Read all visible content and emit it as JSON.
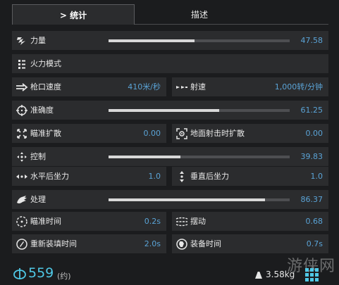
{
  "tabs": [
    {
      "label": "> 统计"
    },
    {
      "label": "描述"
    }
  ],
  "stats": {
    "impact": {
      "label": "力量",
      "value": "47.58",
      "level": 47.58,
      "icon": "impact-icon"
    },
    "fire_mode": {
      "label": "火力模式",
      "icon": "fire-mode-icon"
    },
    "muzzle_velocity": {
      "label": "枪口速度",
      "value": "410米/秒",
      "icon": "muzzle-velocity-icon"
    },
    "rate_of_fire": {
      "label": "射速",
      "value": "1,000转/分钟",
      "icon": "rate-of-fire-icon"
    },
    "accuracy": {
      "label": "准确度",
      "value": "61.25",
      "level": 61.25,
      "icon": "crosshair-icon"
    },
    "ads_spread": {
      "label": "瞄准扩散",
      "value": "0.00",
      "icon": "ads-spread-icon"
    },
    "ground_spread": {
      "label": "地面射击时扩散",
      "value": "0.00",
      "icon": "ground-spread-icon"
    },
    "control": {
      "label": "控制",
      "value": "39.83",
      "level": 39.83,
      "icon": "control-icon"
    },
    "horizontal_recoil": {
      "label": "水平后坐力",
      "value": "1.0",
      "icon": "horizontal-recoil-icon"
    },
    "vertical_recoil": {
      "label": "垂直后坐力",
      "value": "1.0",
      "icon": "vertical-recoil-icon"
    },
    "handling": {
      "label": "处理",
      "value": "86.37",
      "level": 86.37,
      "icon": "handling-icon"
    },
    "ads_time": {
      "label": "瞄准时间",
      "value": "0.2s",
      "icon": "ads-time-icon"
    },
    "sway": {
      "label": "摆动",
      "value": "0.68",
      "icon": "sway-icon"
    },
    "reload_time": {
      "label": "重新装填时间",
      "value": "2.0s",
      "icon": "reload-icon"
    },
    "equip_time": {
      "label": "装备时间",
      "value": "0.7s",
      "icon": "equip-icon"
    }
  },
  "footer": {
    "power": "559",
    "approx": "(约)",
    "weight": "3.58kg",
    "watermark": "游侠网"
  },
  "colors": {
    "value_blue": "#5aa3d6",
    "power_cyan": "#4fc8e6",
    "row_bg": "#2b2c2e",
    "page_bg": "#1b1c1e"
  }
}
